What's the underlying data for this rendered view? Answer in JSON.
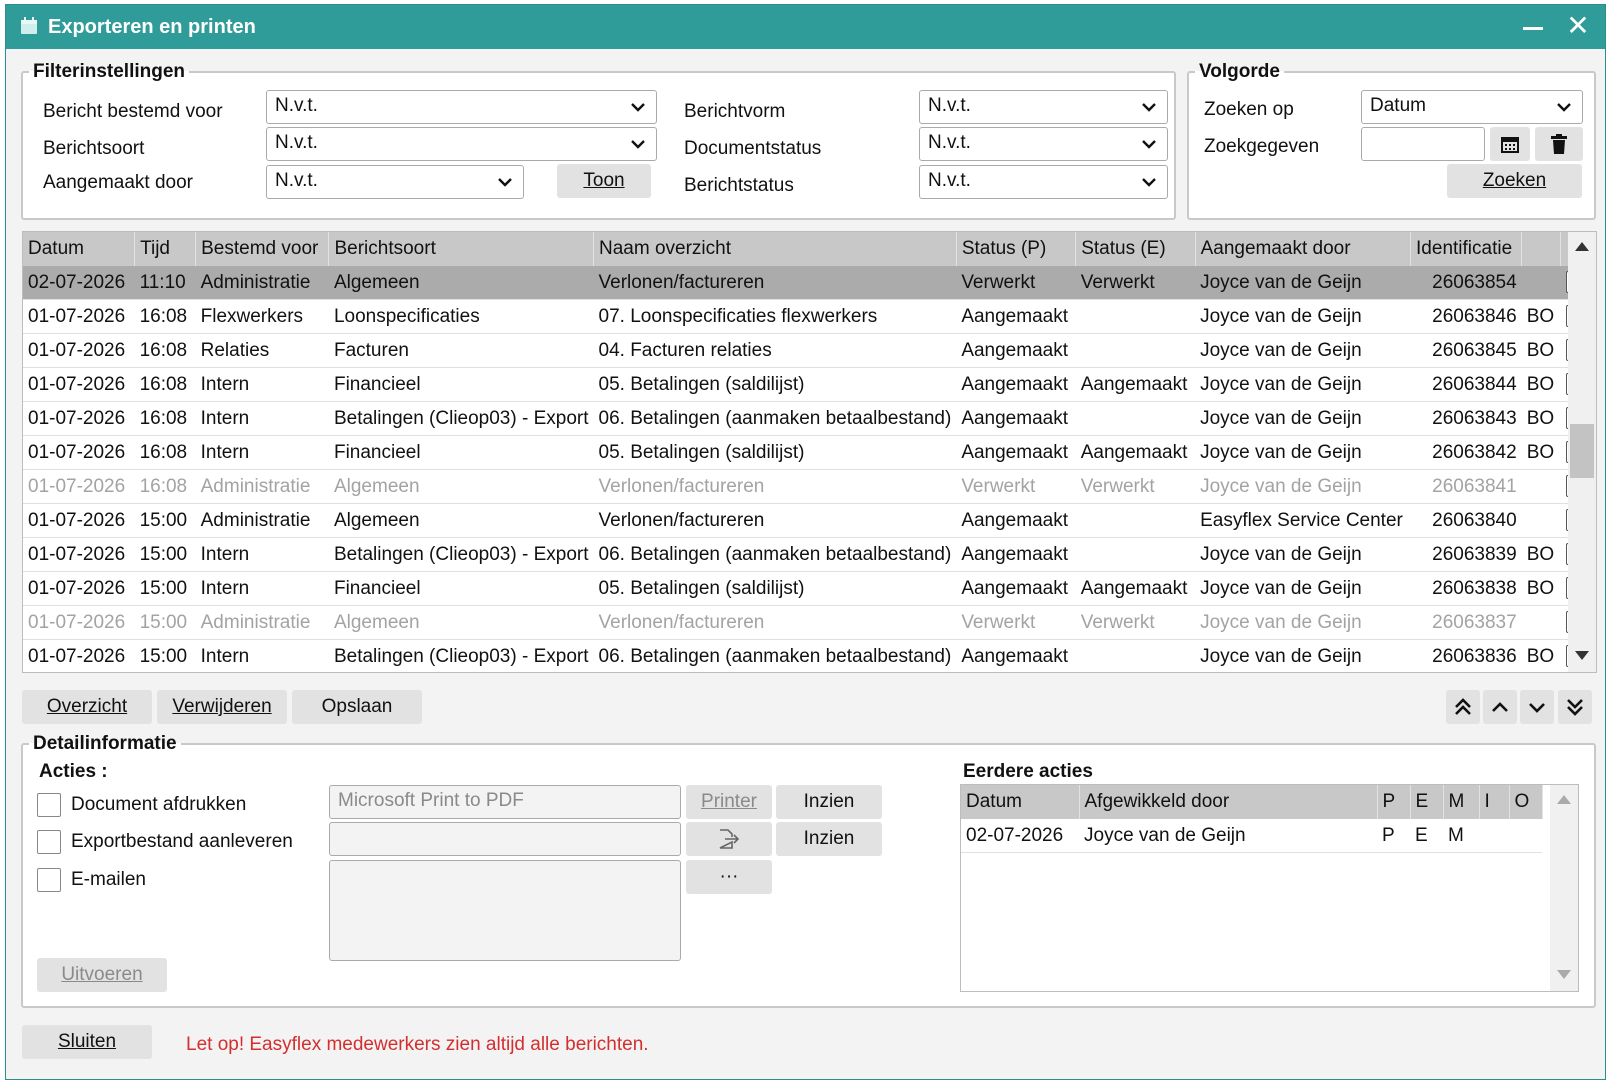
{
  "window": {
    "title": "Exporteren en printen"
  },
  "filter": {
    "legend": "Filterinstellingen",
    "bericht_bestemd_voor_label": "Bericht bestemd voor",
    "bericht_bestemd_voor_value": "N.v.t.",
    "berichtsoort_label": "Berichtsoort",
    "berichtsoort_value": "N.v.t.",
    "aangemaakt_door_label": "Aangemaakt door",
    "aangemaakt_door_value": "N.v.t.",
    "toon_label": "Toon",
    "berichtvorm_label": "Berichtvorm",
    "berichtvorm_value": "N.v.t.",
    "documentstatus_label": "Documentstatus",
    "documentstatus_value": "N.v.t.",
    "berichtstatus_label": "Berichtstatus",
    "berichtstatus_value": "N.v.t."
  },
  "volgorde": {
    "legend": "Volgorde",
    "zoeken_op_label": "Zoeken op",
    "zoeken_op_value": "Datum",
    "zoekgegeven_label": "Zoekgegeven",
    "zoekgegeven_value": "",
    "zoeken_label": "Zoeken"
  },
  "table": {
    "headers": [
      "Datum",
      "Tijd",
      "Bestemd voor",
      "Berichtsoort",
      "Naam overzicht",
      "Status (P)",
      "Status (E)",
      "Aangemaakt door",
      "Identificatie",
      "",
      ""
    ],
    "rows": [
      {
        "datum": "02-07-2026",
        "tijd": "11:10",
        "bestemd": "Administratie",
        "soort": "Algemeen",
        "naam": "Verlonen/factureren",
        "sp": "Verwerkt",
        "se": "Verwerkt",
        "door": "Joyce van de Geijn",
        "id": "26063854",
        "bo": "",
        "state": "selected"
      },
      {
        "datum": "01-07-2026",
        "tijd": "16:08",
        "bestemd": "Flexwerkers",
        "soort": "Loonspecificaties",
        "naam": "07. Loonspecificaties flexwerkers",
        "sp": "Aangemaakt",
        "se": "",
        "door": "Joyce van de Geijn",
        "id": "26063846",
        "bo": "BO",
        "state": "normal"
      },
      {
        "datum": "01-07-2026",
        "tijd": "16:08",
        "bestemd": "Relaties",
        "soort": "Facturen",
        "naam": "04. Facturen relaties",
        "sp": "Aangemaakt",
        "se": "",
        "door": "Joyce van de Geijn",
        "id": "26063845",
        "bo": "BO",
        "state": "normal"
      },
      {
        "datum": "01-07-2026",
        "tijd": "16:08",
        "bestemd": "Intern",
        "soort": "Financieel",
        "naam": "05. Betalingen (saldilijst)",
        "sp": "Aangemaakt",
        "se": "Aangemaakt",
        "door": "Joyce van de Geijn",
        "id": "26063844",
        "bo": "BO",
        "state": "normal"
      },
      {
        "datum": "01-07-2026",
        "tijd": "16:08",
        "bestemd": "Intern",
        "soort": "Betalingen (Clieop03) - Export",
        "naam": "06. Betalingen (aanmaken betaalbestand)",
        "sp": "Aangemaakt",
        "se": "",
        "door": "Joyce van de Geijn",
        "id": "26063843",
        "bo": "BO",
        "state": "normal"
      },
      {
        "datum": "01-07-2026",
        "tijd": "16:08",
        "bestemd": "Intern",
        "soort": "Financieel",
        "naam": "05. Betalingen (saldilijst)",
        "sp": "Aangemaakt",
        "se": "Aangemaakt",
        "door": "Joyce van de Geijn",
        "id": "26063842",
        "bo": "BO",
        "state": "normal"
      },
      {
        "datum": "01-07-2026",
        "tijd": "16:08",
        "bestemd": "Administratie",
        "soort": "Algemeen",
        "naam": "Verlonen/factureren",
        "sp": "Verwerkt",
        "se": "Verwerkt",
        "door": "Joyce van de Geijn",
        "id": "26063841",
        "bo": "",
        "state": "dim"
      },
      {
        "datum": "01-07-2026",
        "tijd": "15:00",
        "bestemd": "Administratie",
        "soort": "Algemeen",
        "naam": "Verlonen/factureren",
        "sp": "Aangemaakt",
        "se": "",
        "door": "Easyflex Service Center",
        "id": "26063840",
        "bo": "",
        "state": "normal"
      },
      {
        "datum": "01-07-2026",
        "tijd": "15:00",
        "bestemd": "Intern",
        "soort": "Betalingen (Clieop03) - Export",
        "naam": "06. Betalingen (aanmaken betaalbestand)",
        "sp": "Aangemaakt",
        "se": "",
        "door": "Joyce van de Geijn",
        "id": "26063839",
        "bo": "BO",
        "state": "normal"
      },
      {
        "datum": "01-07-2026",
        "tijd": "15:00",
        "bestemd": "Intern",
        "soort": "Financieel",
        "naam": "05. Betalingen (saldilijst)",
        "sp": "Aangemaakt",
        "se": "Aangemaakt",
        "door": "Joyce van de Geijn",
        "id": "26063838",
        "bo": "BO",
        "state": "normal"
      },
      {
        "datum": "01-07-2026",
        "tijd": "15:00",
        "bestemd": "Administratie",
        "soort": "Algemeen",
        "naam": "Verlonen/factureren",
        "sp": "Verwerkt",
        "se": "Verwerkt",
        "door": "Joyce van de Geijn",
        "id": "26063837",
        "bo": "",
        "state": "dim"
      },
      {
        "datum": "01-07-2026",
        "tijd": "15:00",
        "bestemd": "Intern",
        "soort": "Betalingen (Clieop03) - Export",
        "naam": "06. Betalingen (aanmaken betaalbestand)",
        "sp": "Aangemaakt",
        "se": "",
        "door": "Joyce van de Geijn",
        "id": "26063836",
        "bo": "BO",
        "state": "normal"
      }
    ]
  },
  "actions": {
    "overzicht_label": "Overzicht",
    "verwijderen_label": "Verwijderen",
    "opslaan_label": "Opslaan"
  },
  "detail": {
    "legend": "Detailinformatie",
    "acties_label": "Acties :",
    "document_afdrukken_label": "Document afdrukken",
    "exportbestand_label": "Exportbestand aanleveren",
    "emailen_label": "E-mailen",
    "printer_value": "Microsoft Print to PDF",
    "printer_label": "Printer",
    "inzien1_label": "Inzien",
    "inzien2_label": "Inzien",
    "ellipsis_label": "···",
    "uitvoeren_label": "Uitvoeren",
    "eerdere_acties_label": "Eerdere acties",
    "eerdere_headers": [
      "Datum",
      "Afgewikkeld door",
      "P",
      "E",
      "M",
      "I",
      "O"
    ],
    "eerdere_rows": [
      {
        "datum": "02-07-2026",
        "door": "Joyce van de Geijn",
        "p": "P",
        "e": "E",
        "m": "M",
        "i": "",
        "o": ""
      }
    ]
  },
  "footer": {
    "sluiten_label": "Sluiten",
    "warning": "Let op! Easyflex medewerkers zien altijd alle berichten."
  },
  "colors": {
    "titlebar": "#2f9c99",
    "warning": "#d32f2f",
    "selected_row": "#ababab"
  }
}
